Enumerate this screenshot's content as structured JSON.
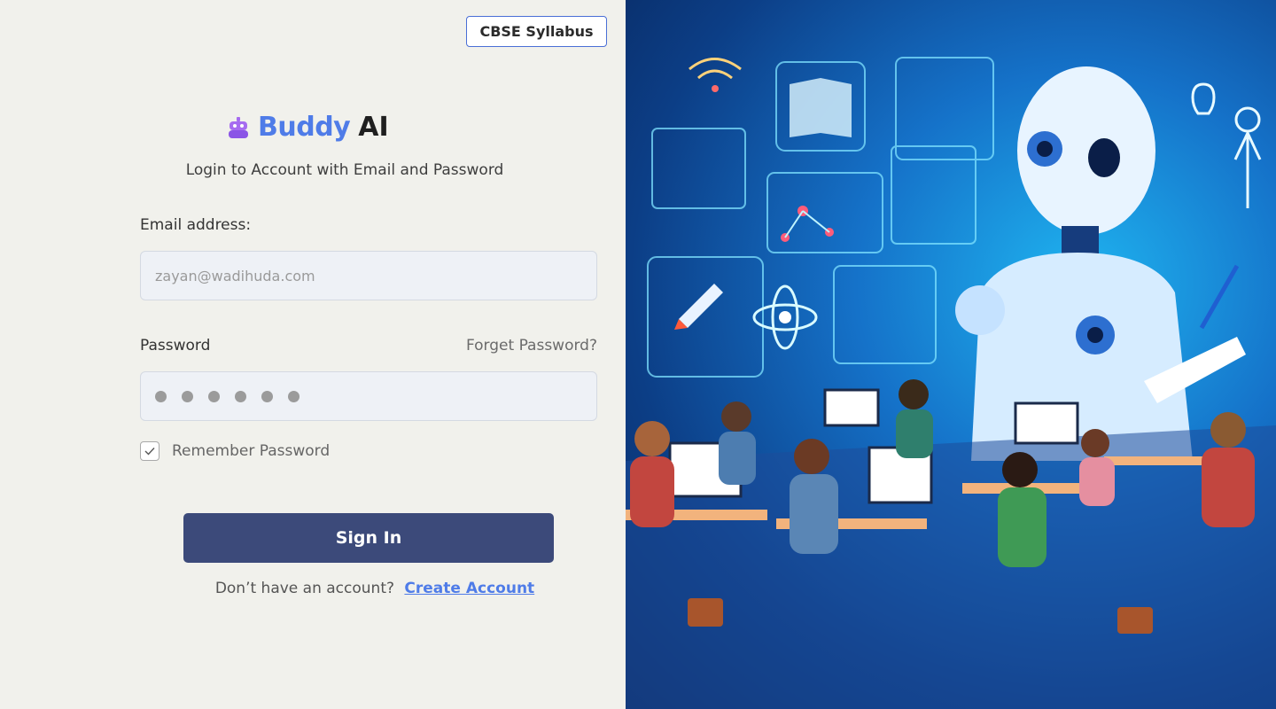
{
  "header": {
    "syllabus_label": "CBSE Syllabus"
  },
  "brand": {
    "name_part1": "Buddy",
    "name_part2": "AI",
    "logo_icon": "robot-icon"
  },
  "form": {
    "subtitle": "Login to Account with Email and Password",
    "email_label": "Email address:",
    "email_placeholder": "zayan@wadihuda.com",
    "password_label": "Password",
    "forgot_label": "Forget Password?",
    "password_masked_length": 6,
    "remember_label": "Remember Password",
    "remember_checked": true,
    "signin_label": "Sign In",
    "signup_prompt": "Don’t have an account?",
    "signup_link": "Create Account"
  },
  "colors": {
    "brand_blue": "#4f7ce8",
    "button_navy": "#3c4a7a",
    "left_bg": "#f1f1ec",
    "hero_accent": "#1fb4f0"
  },
  "hero": {
    "illustration": "ai-robot-teacher-classroom-illustration"
  }
}
